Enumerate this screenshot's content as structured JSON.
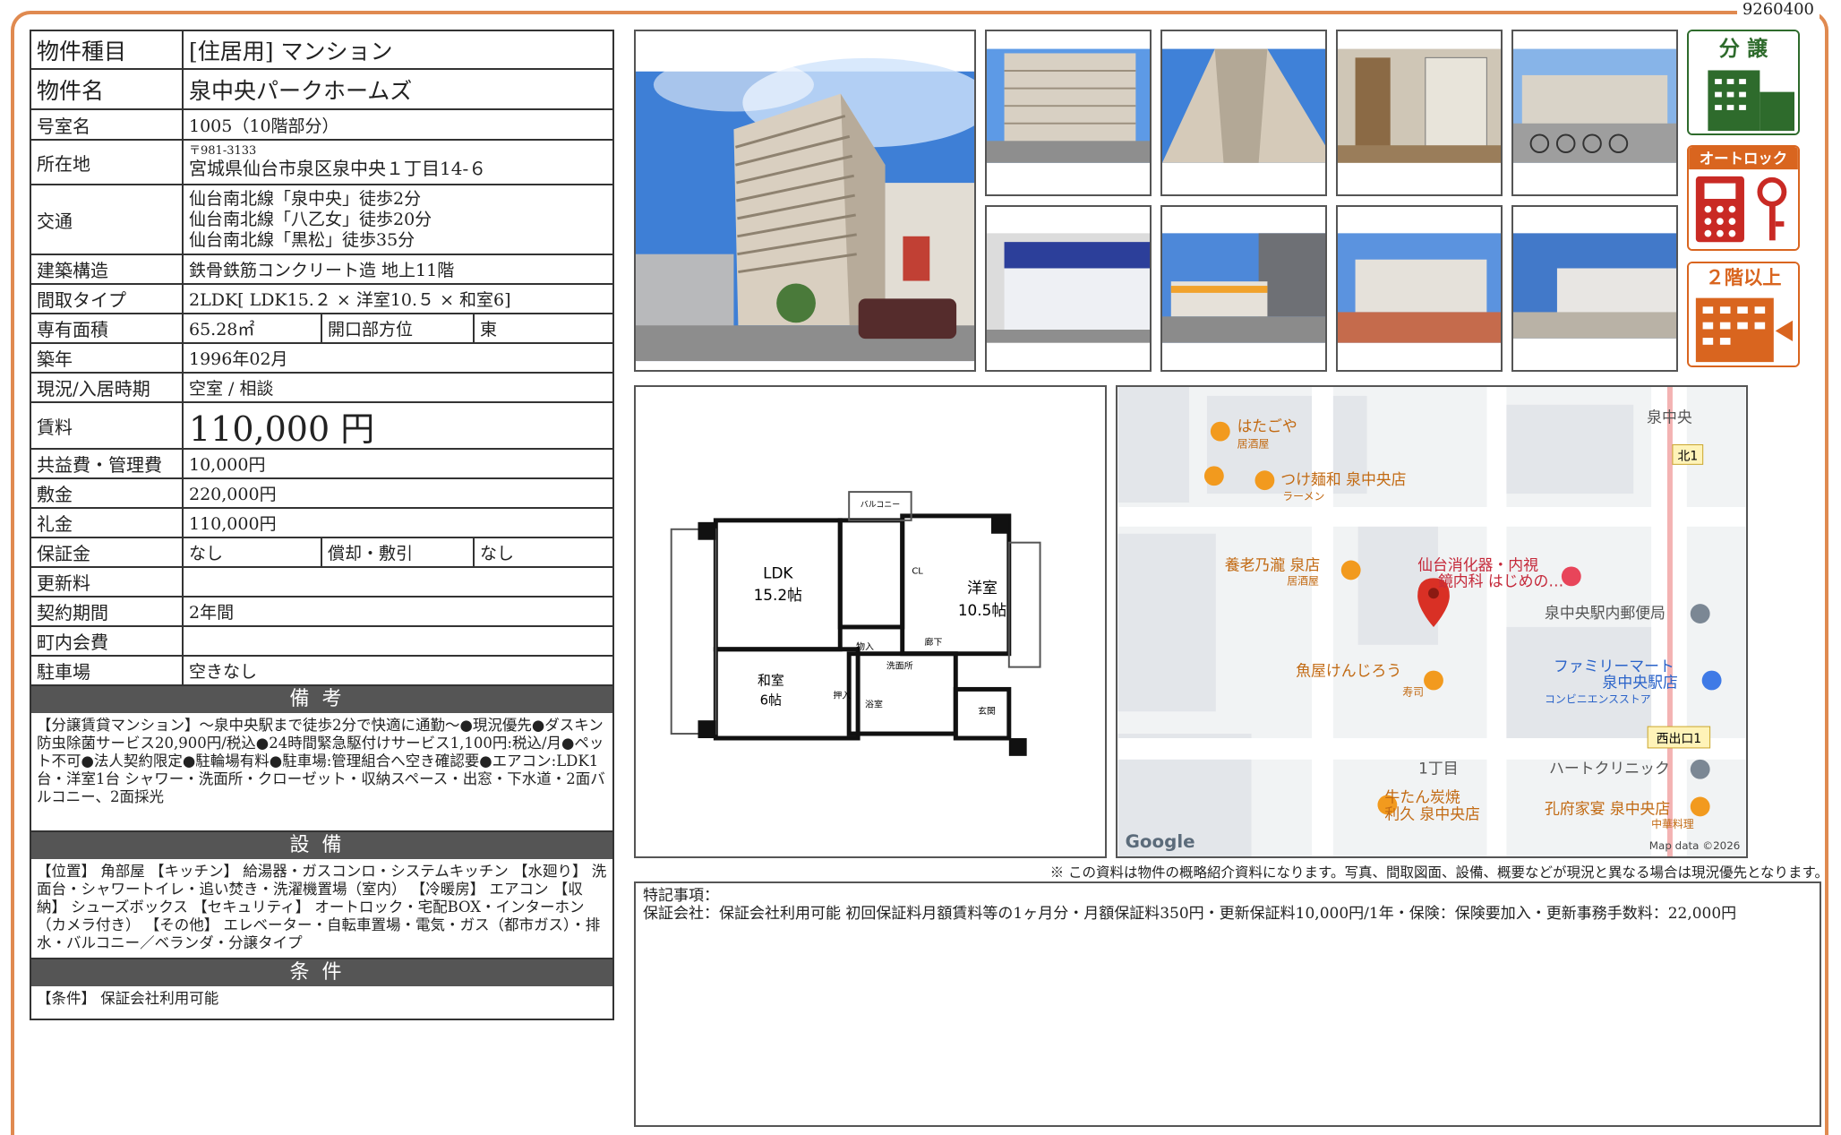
{
  "doc_number": "9260400",
  "property": {
    "type_label": "物件種目",
    "type_value": "[住居用] マンション",
    "name_label": "物件名",
    "name_value": "泉中央パークホームズ",
    "room_label": "号室名",
    "room_value": "1005（10階部分）",
    "address_label": "所在地",
    "postal": "〒981-3133",
    "address": "宮城県仙台市泉区泉中央１丁目14-６",
    "access_label": "交通",
    "access": [
      "仙台南北線「泉中央」徒歩2分",
      "仙台南北線「八乙女」徒歩20分",
      "仙台南北線「黒松」徒歩35分"
    ],
    "structure_label": "建築構造",
    "structure_value": "鉄骨鉄筋コンクリート造 地上11階",
    "layout_label": "間取タイプ",
    "layout_value": "2LDK[ LDK15.２ × 洋室10.５ × 和室6]",
    "area_label": "専有面積",
    "area_value": "65.28㎡",
    "direction_label": "開口部方位",
    "direction_value": "東",
    "built_label": "築年",
    "built_value": "1996年02月",
    "status_label": "現況/入居時期",
    "status_value": "空室 / 相談",
    "rent_label": "賃料",
    "rent_value": "110,000 円",
    "fee_label": "共益費・管理費",
    "fee_value": "10,000円",
    "deposit_label": "敷金",
    "deposit_value": "220,000円",
    "key_label": "礼金",
    "key_value": "110,000円",
    "guarantee_label": "保証金",
    "guarantee_value": "なし",
    "amort_label": "償却・敷引",
    "amort_value": "なし",
    "renewal_label": "更新料",
    "renewal_value": "",
    "contract_label": "契約期間",
    "contract_value": "2年間",
    "assoc_label": "町内会費",
    "assoc_value": "",
    "parking_label": "駐車場",
    "parking_value": "空きなし"
  },
  "remarks": {
    "title": "備考",
    "text": "【分譲賃貸マンション】～泉中央駅まで徒歩2分で快適に通勤～●現況優先●ダスキン防虫除菌サービス20,900円/税込●24時間緊急駆付けサービス1,100円:税込/月●ペット不可●法人契約限定●駐輪場有料●駐車場:管理組合へ空き確認要●エアコン:LDK1台・洋室1台 シャワー・洗面所・クローゼット・収納スペース・出窓・下水道・2面バルコニー、2面採光"
  },
  "equipment": {
    "title": "設備",
    "text": "【位置】 角部屋 【キッチン】 給湯器・ガスコンロ・システムキッチン 【水廻り】 洗面台・シャワートイレ・追い焚き・洗濯機置場（室内） 【冷暖房】 エアコン 【収納】 シューズボックス 【セキュリティ】 オートロック・宅配BOX・インターホン（カメラ付き） 【その他】 エレベーター・自転車置場・電気・ガス（都市ガス）・排水・バルコニー／ベランダ・分譲タイプ"
  },
  "conditions": {
    "title": "条件",
    "text": "【条件】 保証会社利用可能"
  },
  "badges": {
    "bunjo": "分 譲",
    "autolock": "オートロック",
    "floor": "２階以上"
  },
  "floorplan": {
    "ldk": "LDK",
    "ldk_size": "15.2帖",
    "yoshitsu": "洋室",
    "yoshitsu_size": "10.5帖",
    "washitsu": "和室",
    "washitsu_size": "6帖",
    "balcony": "バルコニー",
    "genkan": "玄関",
    "senmen": "洗面所",
    "yokushitsu": "浴室",
    "rouka": "廊下",
    "cl": "CL",
    "oshiire": "押入",
    "storage": "物入"
  },
  "map": {
    "labels": [
      "はたごや",
      "居酒屋",
      "つけ麺和 泉中央店",
      "ラーメン",
      "養老乃瀧 泉店",
      "居酒屋",
      "仙台消化器・内視",
      "鏡内科 はじめの…",
      "泉中央駅内郵便局",
      "ファミリーマート",
      "泉中央駅店",
      "コンビニエンスストア",
      "魚屋けんじろう",
      "寿司",
      "1丁目",
      "ハートクリニック",
      "牛たん炭焼",
      "利久 泉中央店",
      "孔府家宴 泉中央店",
      "中華料理",
      "泉中央",
      "北1",
      "西出口1"
    ],
    "logo": "Google",
    "copyright": "Map data ©2026"
  },
  "disclaimer": "※ この資料は物件の概略紹介資料になります。写真、間取図面、設備、概要などが現況と異なる場合は現況優先となります。",
  "special": {
    "title": "特記事項：",
    "text": "保証会社：保証会社利用可能 初回保証料月額賃料等の1ヶ月分・月額保証料350円・更新保証料10,000円/1年・保険：保険要加入・更新事務手数料：22,000円"
  }
}
